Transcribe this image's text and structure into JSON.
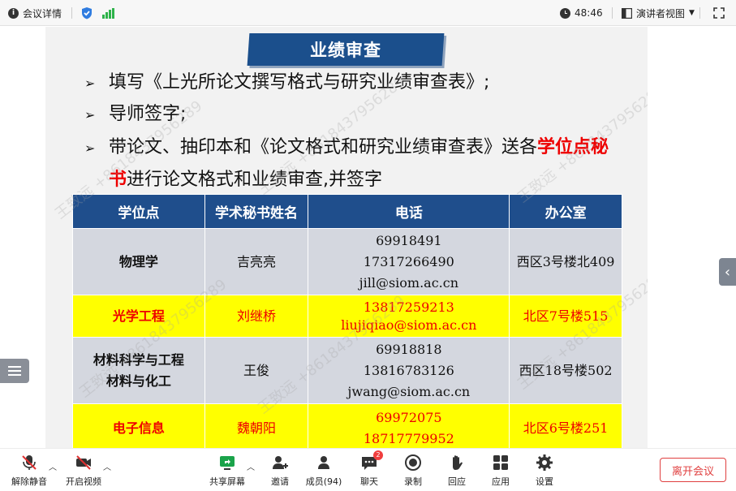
{
  "topbar": {
    "meeting_details": "会议详情",
    "timer": "48:46",
    "view_mode": "演讲者视图"
  },
  "slide": {
    "title": "业绩审查",
    "bullets": [
      {
        "text": "填写《上光所论文撰写格式与研究业绩审查表》;"
      },
      {
        "text": "导师签字;"
      },
      {
        "line1_pre": "带论文、抽印本和《论文格式和研究业绩审查表》送各",
        "line1_red": "学位点秘",
        "line2_red": "书",
        "line2_post": "进行论文格式和业绩审查,并签字"
      }
    ],
    "table": {
      "headers": [
        "学位点",
        "学术秘书姓名",
        "电话",
        "办公室"
      ],
      "rows": [
        {
          "degree": "物理学",
          "secretary": "吉亮亮",
          "contact": [
            "69918491",
            "17317266490",
            "jill@siom.ac.cn"
          ],
          "office": "西区3号楼北409"
        },
        {
          "degree": "光学工程",
          "secretary": "刘继桥",
          "contact": [
            "13817259213",
            "liujiqiao@siom.ac.cn"
          ],
          "office": "北区7号楼515"
        },
        {
          "degree": [
            "材料科学与工程",
            "材料与化工"
          ],
          "secretary": "王俊",
          "contact": [
            "69918818",
            "13816783126",
            "jwang@siom.ac.cn"
          ],
          "office": "西区18号楼502"
        },
        {
          "degree": "电子信息",
          "secretary": "魏朝阳",
          "contact": [
            "69972075",
            "18717779952"
          ],
          "office": "北区6号楼251"
        }
      ]
    },
    "watermark": "王致远 +8618437956289"
  },
  "toolbar": {
    "unmute": "解除静音",
    "start_video": "开启视频",
    "share_screen": "共享屏幕",
    "invite": "邀请",
    "members": "成员(94)",
    "chat": "聊天",
    "chat_badge": "2",
    "record": "录制",
    "react": "回应",
    "apps": "应用",
    "settings": "设置",
    "leave": "离开会议"
  },
  "colors": {
    "header_blue": "#1f4e8c",
    "highlight_yellow": "#ffff00",
    "highlight_red": "#e00000",
    "leave_red": "#e04040"
  }
}
